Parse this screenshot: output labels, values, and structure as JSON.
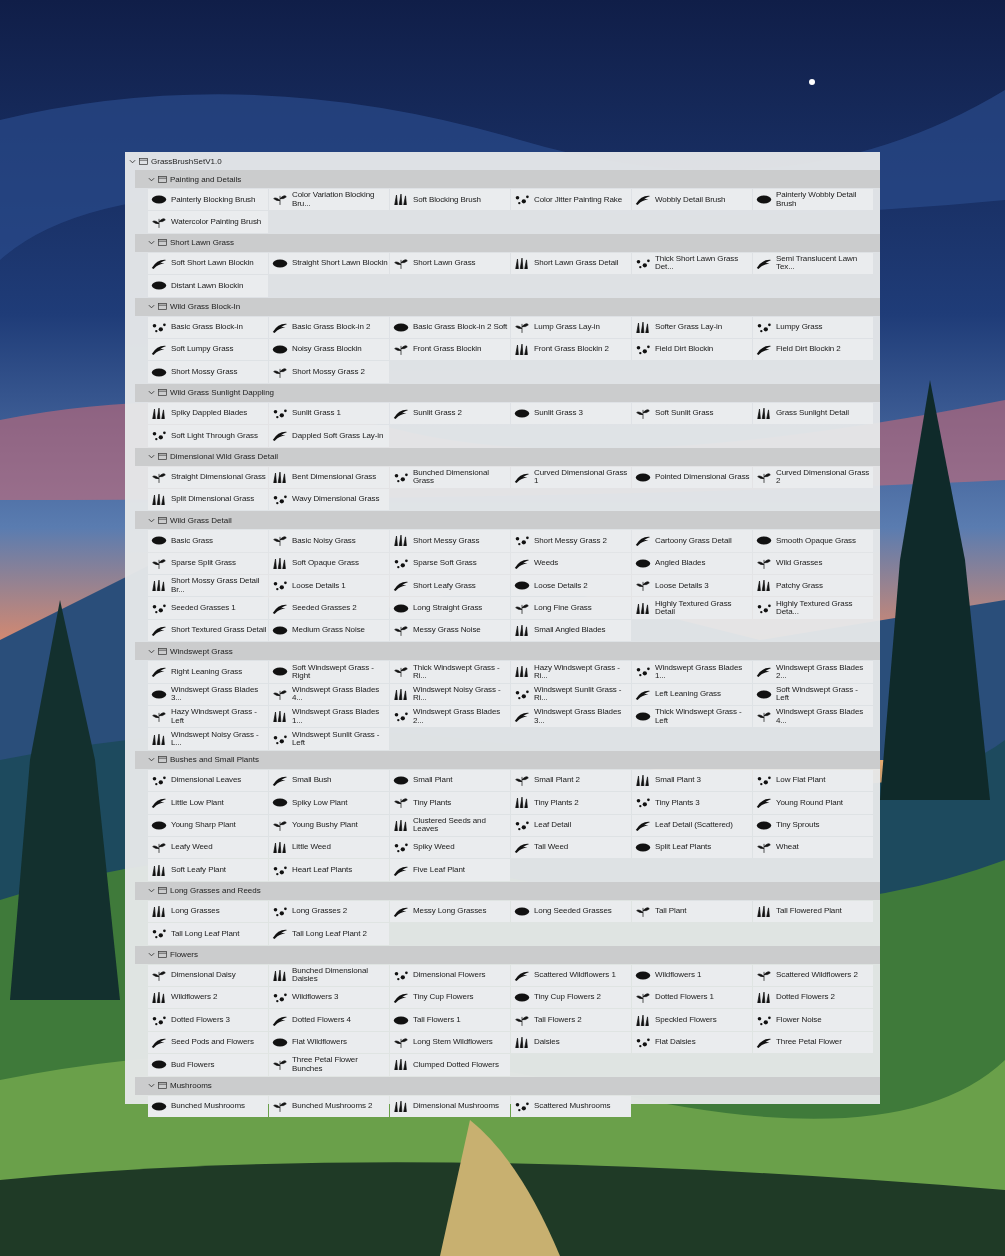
{
  "root": {
    "name": "GrassBrushSetV1.0",
    "expanded": true
  },
  "groups": [
    {
      "name": "Painting and Details",
      "expanded": true,
      "brushes": [
        "Painterly Blocking Brush",
        "Color Variation Blocking Bru...",
        "Soft Blocking Brush",
        "Color Jitter Painting Rake",
        "Wobbly Detail Brush",
        "Painterly Wobbly Detail Brush",
        "Watercolor Painting Brush"
      ]
    },
    {
      "name": "Short Lawn Grass",
      "expanded": true,
      "brushes": [
        "Soft Short Lawn Blockin",
        "Straight Short Lawn Blockin",
        "Short Lawn Grass",
        "Short Lawn Grass Detail",
        "Thick Short Lawn Grass Det...",
        "Semi Translucent Lawn Tex...",
        "Distant Lawn Blockin"
      ]
    },
    {
      "name": "Wild Grass Block-In",
      "expanded": true,
      "brushes": [
        "Basic Grass Block-in",
        "Basic Grass Block-in 2",
        "Basic Grass Block-in 2 Soft",
        "Lump Grass Lay-in",
        "Softer Grass Lay-in",
        "Lumpy Grass",
        "Soft Lumpy Grass",
        "Noisy Grass Blockin",
        "Front Grass Blockin",
        "Front Grass Blockin 2",
        "Field Dirt Blockin",
        "Field Dirt Blockin 2",
        "Short Mossy Grass",
        "Short Mossy Grass 2"
      ]
    },
    {
      "name": "Wild Grass Sunlight Dappling",
      "expanded": true,
      "brushes": [
        "Spiky Dappled Blades",
        "Sunlit Grass 1",
        "Sunlit Grass 2",
        "Sunlit Grass 3",
        "Soft Sunlit Grass",
        "Grass Sunlight Detail",
        "Soft Light Through Grass",
        "Dappled Soft Grass Lay-in"
      ]
    },
    {
      "name": "Dimensional Wild Grass Detail",
      "expanded": true,
      "brushes": [
        "Straight Dimensional Grass",
        "Bent Dimensional Grass",
        "Bunched Dimensional Grass",
        "Curved Dimensional Grass 1",
        "Pointed Dimensional Grass",
        "Curved Dimensional Grass 2",
        "Split Dimensional Grass",
        "Wavy Dimensional Grass"
      ]
    },
    {
      "name": "Wild Grass Detail",
      "expanded": true,
      "brushes": [
        "Basic Grass",
        "Basic Noisy Grass",
        "Short Messy Grass",
        "Short Messy Grass 2",
        "Cartoony Grass Detail",
        "Smooth Opaque Grass",
        "Sparse Split Grass",
        "Soft Opaque Grass",
        "Sparse Soft Grass",
        "Weeds",
        "Angled Blades",
        "Wild Grasses",
        "Short Mossy Grass Detail Br...",
        "Loose Details 1",
        "Short Leafy Grass",
        "Loose Details 2",
        "Loose Details 3",
        "Patchy Grass",
        "Seeded Grasses 1",
        "Seeded Grasses 2",
        "Long Straight Grass",
        "Long Fine Grass",
        "Highly Textured Grass Detail",
        "Highly Textured Grass Deta...",
        "Short Textured Grass Detail",
        "Medium Grass Noise",
        "Messy Grass Noise",
        "Small Angled Blades"
      ]
    },
    {
      "name": "Windswept Grass",
      "expanded": true,
      "brushes": [
        "Right Leaning Grass",
        "Soft Windswept Grass - Right",
        "Thick Windswept Grass - Ri...",
        "Hazy Windswept Grass - Ri...",
        "Windswept Grass Blades 1...",
        "Windswept Grass Blades 2...",
        "Windswept Grass Blades 3...",
        "Windswept Grass Blades 4...",
        "Windswept Noisy Grass - Ri...",
        "Windswept Sunlit Grass - Ri...",
        "Left Leaning Grass",
        "Soft Windswept Grass - Left",
        "Hazy Windswept Grass - Left",
        "Windswept Grass Blades 1...",
        "Windswept Grass Blades 2...",
        "Windswept Grass Blades 3...",
        "Thick Windswept Grass - Left",
        "Windswept Grass Blades 4...",
        "Windswept Noisy Grass  - L...",
        "Windswept Sunlit Grass - Left"
      ]
    },
    {
      "name": "Bushes and Small Plants",
      "expanded": true,
      "brushes": [
        "Dimensional Leaves",
        "Small Bush",
        "Small Plant",
        "Small Plant 2",
        "Small Plant 3",
        "Low Flat Plant",
        "Little Low Plant",
        "Spiky Low Plant",
        "Tiny Plants",
        "Tiny Plants 2",
        "Tiny Plants 3",
        "Young Round Plant",
        "Young Sharp Plant",
        "Young Bushy Plant",
        "Clustered Seeds and Leaves",
        "Leaf Detail",
        "Leaf Detail (Scattered)",
        "Tiny Sprouts",
        "Leafy Weed",
        "Little Weed",
        "Spiky Weed",
        "Tall Weed",
        "Split Leaf Plants",
        "Wheat",
        "Soft Leafy Plant",
        "Heart Leaf Plants",
        "Five Leaf Plant"
      ]
    },
    {
      "name": "Long Grasses and Reeds",
      "expanded": true,
      "brushes": [
        "Long Grasses",
        "Long Grasses 2",
        "Messy Long Grasses",
        "Long Seeded Grasses",
        "Tall Plant",
        "Tall Flowered Plant",
        "Tall Long Leaf Plant",
        "Tall Long Leaf Plant 2"
      ]
    },
    {
      "name": "Flowers",
      "expanded": true,
      "brushes": [
        "Dimensional Daisy",
        "Bunched Dimensional Daisies",
        "Dimensional Flowers",
        "Scattered Wildflowers 1",
        "Wildflowers 1",
        "Scattered Wildflowers 2",
        "Wildflowers 2",
        "Wildflowers 3",
        "Tiny Cup Flowers",
        "Tiny Cup Flowers 2",
        "Dotted Flowers 1",
        "Dotted Flowers 2",
        "Dotted Flowers 3",
        "Dotted Flowers 4",
        "Tall Flowers 1",
        "Tall Flowers 2",
        "Speckled Flowers",
        "Flower Noise",
        "Seed Pods and Flowers",
        "Flat Wildflowers",
        "Long Stem Wildflowers",
        "Daisies",
        "Flat Daisies",
        "Three Petal Flower",
        "Bud Flowers",
        "Three Petal Flower Bunches",
        "Clumped Dotted Flowers"
      ]
    },
    {
      "name": "Mushrooms",
      "expanded": true,
      "brushes": [
        "Bunched Mushrooms",
        "Bunched Mushrooms 2",
        "Dimensional Mushrooms",
        "Scattered Mushrooms"
      ]
    }
  ]
}
